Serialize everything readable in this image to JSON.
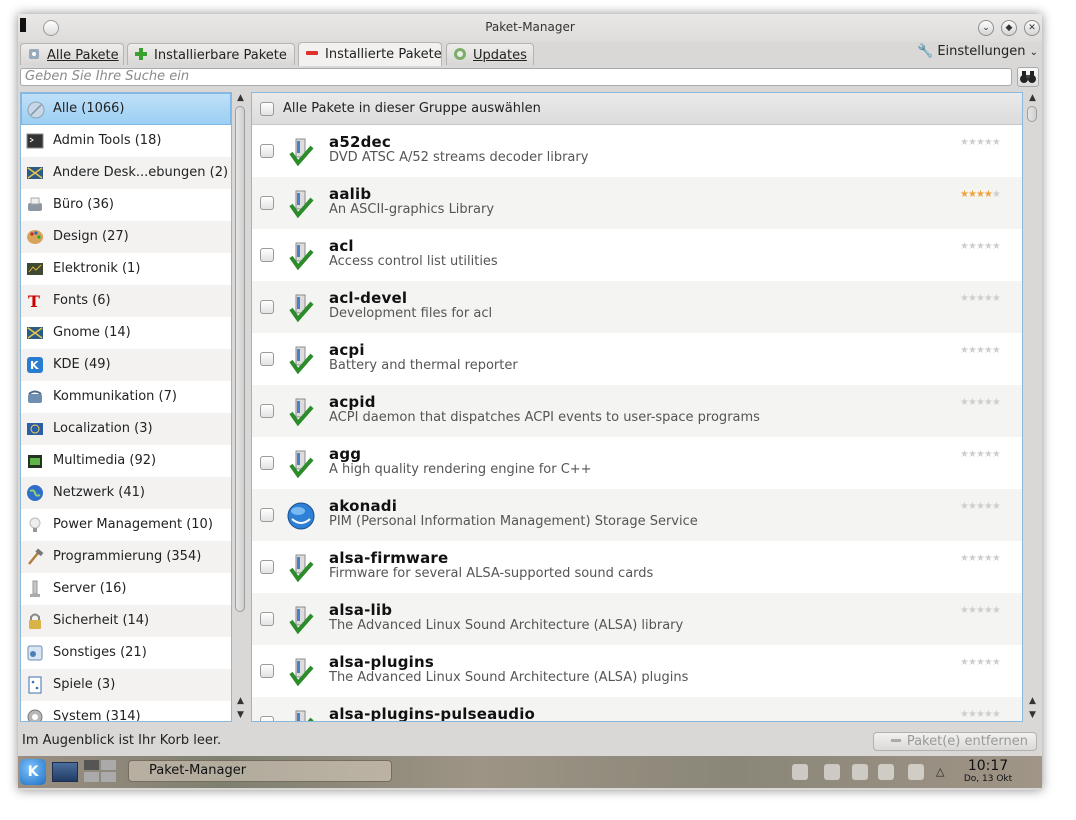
{
  "window": {
    "title": "Paket-Manager",
    "buttons": [
      "minimize",
      "maximize",
      "close"
    ]
  },
  "tabs": [
    {
      "label": "Alle Pakete",
      "icon": "all-packages-icon",
      "active": false
    },
    {
      "label": "Installierbare Pakete",
      "icon": "plus-icon",
      "active": false
    },
    {
      "label": "Installierte Pakete",
      "icon": "minus-icon",
      "active": true
    },
    {
      "label": "Updates",
      "icon": "updates-icon",
      "active": false
    }
  ],
  "settings_label": "Einstellungen",
  "search": {
    "placeholder": "Geben Sie Ihre Suche ein"
  },
  "categories": [
    {
      "label": "Alle (1066)",
      "icon": "all-icon",
      "selected": true
    },
    {
      "label": "Admin Tools (18)",
      "icon": "terminal-icon"
    },
    {
      "label": "Andere Desk...ebungen (2)",
      "icon": "desktop-icon"
    },
    {
      "label": "Büro (36)",
      "icon": "typewriter-icon"
    },
    {
      "label": "Design (27)",
      "icon": "palette-icon"
    },
    {
      "label": "Elektronik (1)",
      "icon": "circuit-icon"
    },
    {
      "label": "Fonts (6)",
      "icon": "font-icon"
    },
    {
      "label": "Gnome (14)",
      "icon": "gnome-icon"
    },
    {
      "label": "KDE (49)",
      "icon": "kde-icon"
    },
    {
      "label": "Kommunikation (7)",
      "icon": "phone-icon"
    },
    {
      "label": "Localization (3)",
      "icon": "flag-icon"
    },
    {
      "label": "Multimedia (92)",
      "icon": "film-icon"
    },
    {
      "label": "Netzwerk (41)",
      "icon": "globe-icon"
    },
    {
      "label": "Power Management (10)",
      "icon": "bulb-icon"
    },
    {
      "label": "Programmierung (354)",
      "icon": "hammer-icon"
    },
    {
      "label": "Server (16)",
      "icon": "server-icon"
    },
    {
      "label": "Sicherheit (14)",
      "icon": "lock-icon"
    },
    {
      "label": "Sonstiges (21)",
      "icon": "misc-icon"
    },
    {
      "label": "Spiele (3)",
      "icon": "dice-icon"
    },
    {
      "label": "System (314)",
      "icon": "gear-icon"
    }
  ],
  "list_header": {
    "select_all_label": "Alle Pakete in dieser Gruppe auswählen"
  },
  "packages": [
    {
      "name": "a52dec",
      "description": "DVD ATSC A/52 streams decoder library",
      "rating": 0,
      "icon": "package-installed-icon"
    },
    {
      "name": "aalib",
      "description": "An ASCII-graphics Library",
      "rating": 4,
      "icon": "package-installed-icon"
    },
    {
      "name": "acl",
      "description": "Access control list utilities",
      "rating": 0,
      "icon": "package-installed-icon"
    },
    {
      "name": "acl-devel",
      "description": "Development files for acl",
      "rating": 0,
      "icon": "package-installed-icon"
    },
    {
      "name": "acpi",
      "description": "Battery and thermal reporter",
      "rating": 0,
      "icon": "package-installed-icon"
    },
    {
      "name": "acpid",
      "description": "ACPI daemon that dispatches ACPI events to user-space programs",
      "rating": 0,
      "icon": "package-installed-icon"
    },
    {
      "name": "agg",
      "description": "A high quality rendering engine for C++",
      "rating": 0,
      "icon": "package-installed-icon"
    },
    {
      "name": "akonadi",
      "description": "PIM (Personal Information Management) Storage Service",
      "rating": 0,
      "icon": "akonadi-globe-icon"
    },
    {
      "name": "alsa-firmware",
      "description": "Firmware for several ALSA-supported sound cards",
      "rating": 0,
      "icon": "package-installed-icon"
    },
    {
      "name": "alsa-lib",
      "description": "The Advanced Linux Sound Architecture (ALSA) library",
      "rating": 0,
      "icon": "package-installed-icon"
    },
    {
      "name": "alsa-plugins",
      "description": "The Advanced Linux Sound Architecture (ALSA) plugins",
      "rating": 0,
      "icon": "package-installed-icon"
    },
    {
      "name": "alsa-plugins-pulseaudio",
      "description": "",
      "rating": 0,
      "icon": "package-installed-icon"
    }
  ],
  "status": {
    "basket_text": "Im Augenblick ist Ihr Korb leer.",
    "remove_button": "Paket(e) entfernen"
  },
  "taskbar": {
    "task_label": "Paket-Manager",
    "time": "10:17",
    "date": "Do, 13 Okt"
  }
}
